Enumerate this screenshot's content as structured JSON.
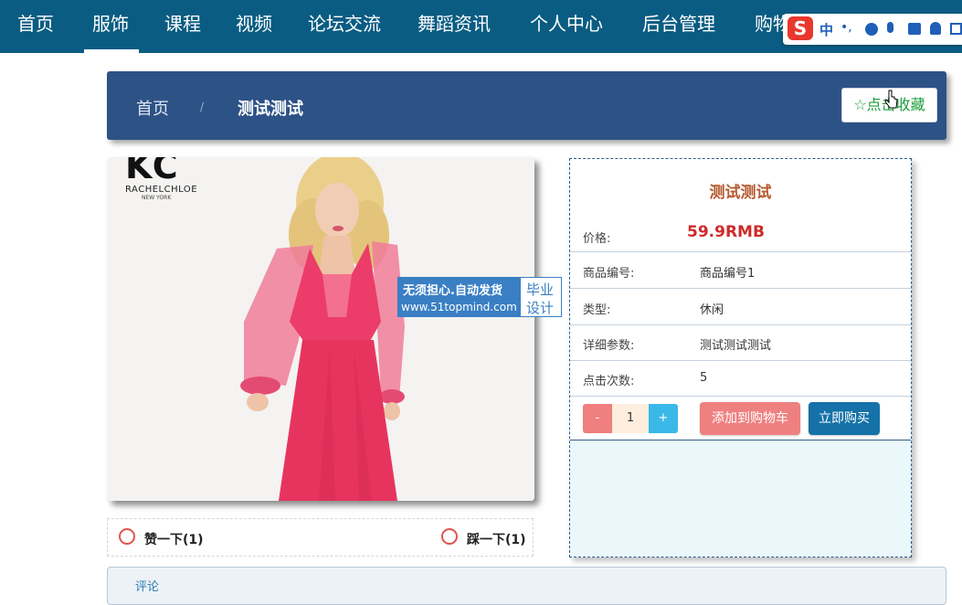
{
  "nav": {
    "items": [
      "首页",
      "服饰",
      "课程",
      "视频",
      "论坛交流",
      "舞蹈资讯",
      "个人中心",
      "后台管理",
      "购物车"
    ],
    "active_index": 1
  },
  "ime": {
    "logo": "S",
    "mode": "中",
    "punct": "•,",
    "icons": [
      "emoji-icon",
      "microphone-icon",
      "keyboard-icon",
      "user-icon",
      "grid-icon"
    ]
  },
  "breadcrumb": {
    "home": "首页",
    "separator": "/",
    "current": "测试测试"
  },
  "favorite_button": {
    "label": "☆点击收藏"
  },
  "product_image": {
    "brand_mark": "KC",
    "brand_name": "RACHELCHLOE",
    "brand_sub": "NEW YORK",
    "watermark_line1": "无须担心.自动发货",
    "watermark_line2": "www.51topmind.com",
    "watermark_tag1": "毕业",
    "watermark_tag2": "设计"
  },
  "reactions": {
    "like_label": "赞一下(1)",
    "dislike_label": "踩一下(1)"
  },
  "product": {
    "title": "测试测试",
    "price_label": "价格:",
    "price_value": "59.9RMB",
    "code_label": "商品编号:",
    "code_value": "商品编号1",
    "type_label": "类型:",
    "type_value": "休闲",
    "params_label": "详细参数:",
    "params_value": "测试测试测试",
    "clicks_label": "点击次数:",
    "clicks_value": "5"
  },
  "purchase": {
    "minus": "-",
    "quantity": "1",
    "plus": "+",
    "add_to_cart": "添加到购物车",
    "buy_now": "立即购买"
  },
  "comments": {
    "title": "评论"
  },
  "colors": {
    "nav_bg": "#0a5c82",
    "crumb_bg": "#2d5286",
    "price": "#cf2a2a",
    "title": "#b5582e",
    "cart_btn": "#ef8080",
    "buy_btn": "#1472a8"
  }
}
